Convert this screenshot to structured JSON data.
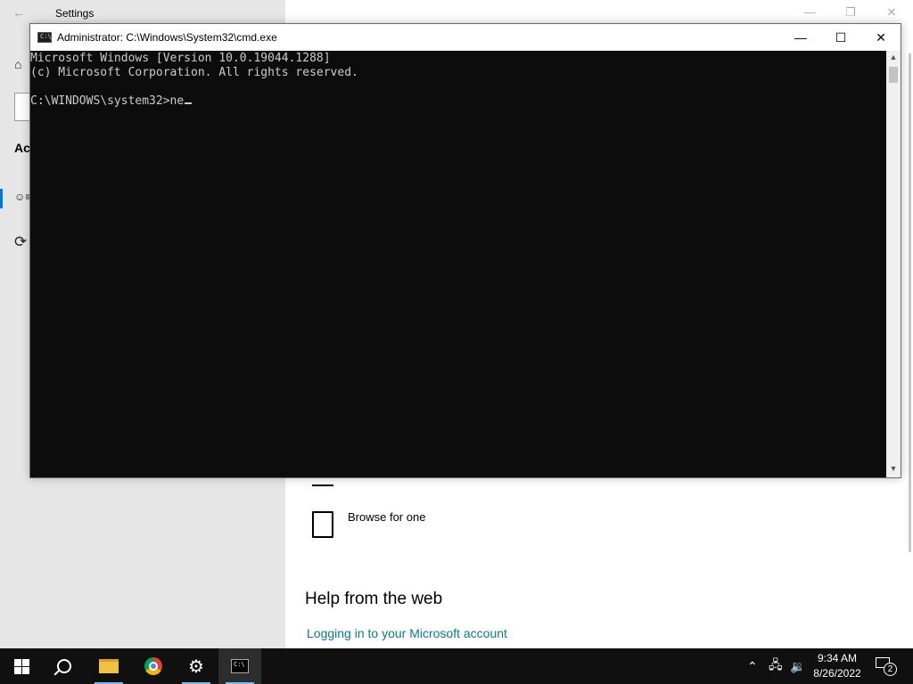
{
  "settings": {
    "title": "Settings",
    "section_partial": "Ac",
    "browse_label": "Browse for one",
    "help_heading": "Help from the web",
    "help_link": "Logging in to your Microsoft account"
  },
  "cmd": {
    "title": "Administrator: C:\\Windows\\System32\\cmd.exe",
    "lines": [
      "Microsoft Windows [Version 10.0.19044.1288]",
      "(c) Microsoft Corporation. All rights reserved.",
      "",
      "C:\\WINDOWS\\system32>ne"
    ],
    "icon_text": "C:\\"
  },
  "taskbar": {
    "apps": [
      "start",
      "search",
      "file-explorer",
      "chrome",
      "settings",
      "command-prompt"
    ],
    "active": "command-prompt",
    "time": "9:34 AM",
    "date": "8/26/2022",
    "notification_count": "2"
  },
  "colors": {
    "console_bg": "#0c0c0c",
    "console_text": "#cccccc",
    "taskbar_bg": "#101010",
    "accent": "#0078d4",
    "link": "#0a7a8a"
  }
}
